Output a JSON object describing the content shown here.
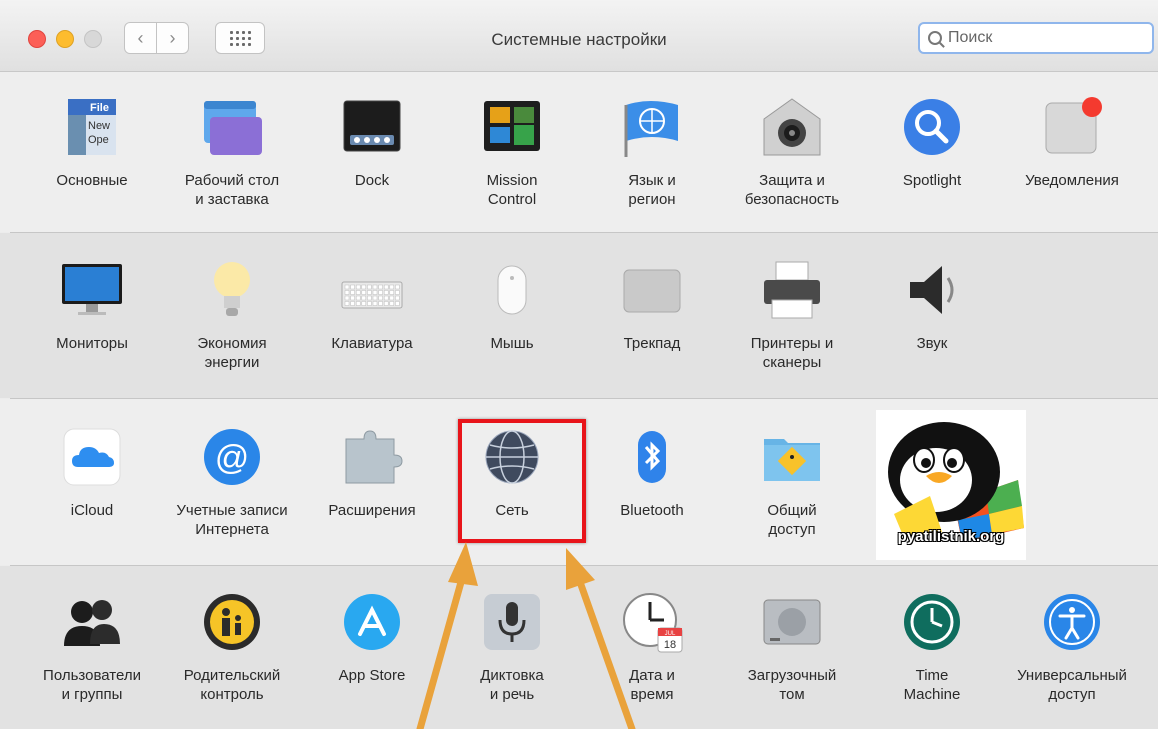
{
  "window": {
    "title": "Системные настройки"
  },
  "search": {
    "placeholder": "Поиск"
  },
  "rows": [
    [
      {
        "id": "general",
        "label": "Основные",
        "icon": "general-icon"
      },
      {
        "id": "desktop",
        "label": "Рабочий стол\nи заставка",
        "icon": "desktop-screensaver-icon"
      },
      {
        "id": "dock",
        "label": "Dock",
        "icon": "dock-icon"
      },
      {
        "id": "mission",
        "label": "Mission\nControl",
        "icon": "mission-control-icon"
      },
      {
        "id": "language",
        "label": "Язык и\nрегион",
        "icon": "language-region-icon"
      },
      {
        "id": "security",
        "label": "Защита и\nбезопасность",
        "icon": "security-icon"
      },
      {
        "id": "spotlight",
        "label": "Spotlight",
        "icon": "spotlight-icon"
      },
      {
        "id": "notifications",
        "label": "Уведомления",
        "icon": "notifications-icon"
      }
    ],
    [
      {
        "id": "displays",
        "label": "Мониторы",
        "icon": "displays-icon"
      },
      {
        "id": "energy",
        "label": "Экономия\nэнергии",
        "icon": "energy-saver-icon"
      },
      {
        "id": "keyboard",
        "label": "Клавиатура",
        "icon": "keyboard-icon"
      },
      {
        "id": "mouse",
        "label": "Мышь",
        "icon": "mouse-icon"
      },
      {
        "id": "trackpad",
        "label": "Трекпад",
        "icon": "trackpad-icon"
      },
      {
        "id": "printers",
        "label": "Принтеры и\nсканеры",
        "icon": "printer-icon"
      },
      {
        "id": "sound",
        "label": "Звук",
        "icon": "sound-icon"
      }
    ],
    [
      {
        "id": "icloud",
        "label": "iCloud",
        "icon": "icloud-icon"
      },
      {
        "id": "accounts",
        "label": "Учетные записи\nИнтернета",
        "icon": "internet-accounts-icon"
      },
      {
        "id": "extensions",
        "label": "Расширения",
        "icon": "extensions-icon"
      },
      {
        "id": "network",
        "label": "Сеть",
        "icon": "network-globe-icon"
      },
      {
        "id": "bluetooth",
        "label": "Bluetooth",
        "icon": "bluetooth-icon"
      },
      {
        "id": "sharing",
        "label": "Общий\nдоступ",
        "icon": "sharing-icon"
      }
    ],
    [
      {
        "id": "users",
        "label": "Пользователи\nи группы",
        "icon": "users-groups-icon"
      },
      {
        "id": "parental",
        "label": "Родительский\nконтроль",
        "icon": "parental-controls-icon"
      },
      {
        "id": "appstore",
        "label": "App Store",
        "icon": "app-store-icon"
      },
      {
        "id": "dictation",
        "label": "Диктовка\nи речь",
        "icon": "dictation-microphone-icon"
      },
      {
        "id": "datetime",
        "label": "Дата и\nвремя",
        "icon": "date-time-icon"
      },
      {
        "id": "startup",
        "label": "Загрузочный\nтом",
        "icon": "startup-disk-icon"
      },
      {
        "id": "timemachine",
        "label": "Time\nMachine",
        "icon": "time-machine-icon"
      },
      {
        "id": "accessibility",
        "label": "Универсальный\nдоступ",
        "icon": "accessibility-icon"
      }
    ]
  ],
  "icon_texts": {
    "general": [
      "File",
      "New",
      "Ope"
    ],
    "calendar_month": "JUL",
    "calendar_day": "18"
  },
  "watermark": {
    "text": "pyatilistnik.org"
  },
  "highlight": {
    "color": "#e8141a"
  },
  "arrow_color": "#e9a23b"
}
